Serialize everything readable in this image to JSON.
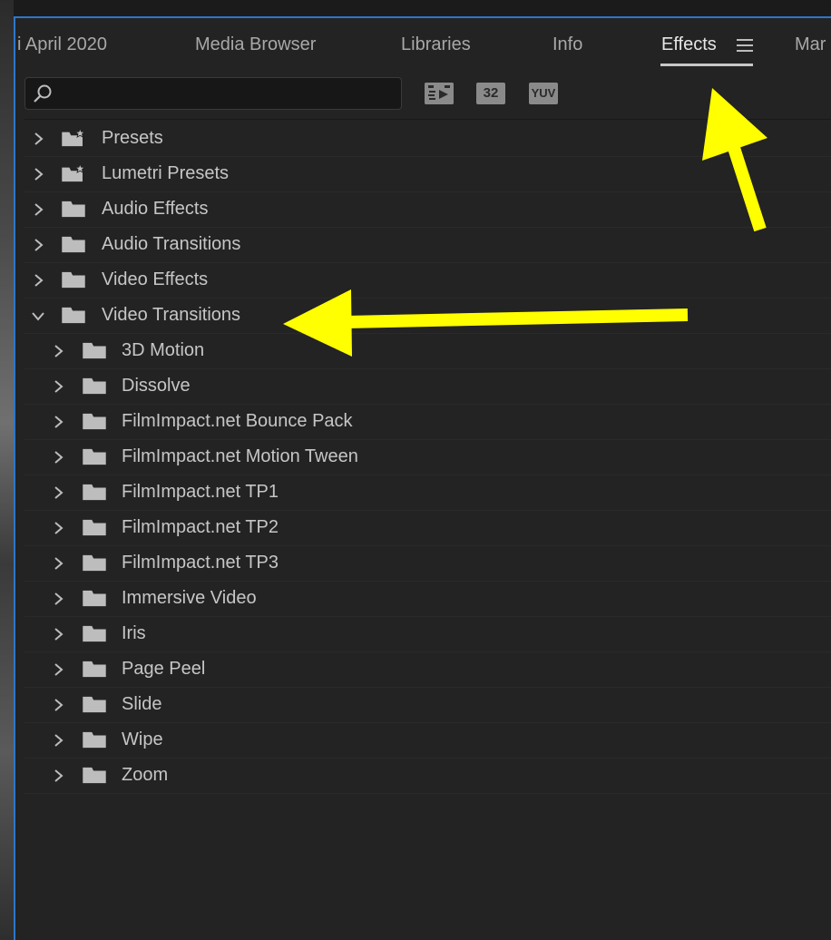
{
  "tabs": [
    {
      "label": "i April 2020",
      "active": false
    },
    {
      "label": "Media Browser",
      "active": false
    },
    {
      "label": "Libraries",
      "active": false
    },
    {
      "label": "Info",
      "active": false
    },
    {
      "label": "Effects",
      "active": true
    },
    {
      "label": "Mar",
      "active": false
    }
  ],
  "search": {
    "value": "",
    "placeholder": ""
  },
  "filters": {
    "accelerated_icon": "accelerated-effects-icon",
    "bit32_label": "32",
    "yuv_label": "YUV"
  },
  "tree": [
    {
      "label": "Presets",
      "expanded": false,
      "icon": "preset-folder-icon"
    },
    {
      "label": "Lumetri Presets",
      "expanded": false,
      "icon": "preset-folder-icon"
    },
    {
      "label": "Audio Effects",
      "expanded": false,
      "icon": "folder-icon"
    },
    {
      "label": "Audio Transitions",
      "expanded": false,
      "icon": "folder-icon"
    },
    {
      "label": "Video Effects",
      "expanded": false,
      "icon": "folder-icon"
    },
    {
      "label": "Video Transitions",
      "expanded": true,
      "icon": "folder-icon",
      "children": [
        {
          "label": "3D Motion"
        },
        {
          "label": "Dissolve"
        },
        {
          "label": "FilmImpact.net Bounce Pack"
        },
        {
          "label": "FilmImpact.net Motion Tween"
        },
        {
          "label": "FilmImpact.net TP1"
        },
        {
          "label": "FilmImpact.net TP2"
        },
        {
          "label": "FilmImpact.net TP3"
        },
        {
          "label": "Immersive Video"
        },
        {
          "label": "Iris"
        },
        {
          "label": "Page Peel"
        },
        {
          "label": "Slide"
        },
        {
          "label": "Wipe"
        },
        {
          "label": "Zoom"
        }
      ]
    }
  ],
  "colors": {
    "accent": "#2d77c7",
    "annotation_arrow": "#ffff00"
  }
}
